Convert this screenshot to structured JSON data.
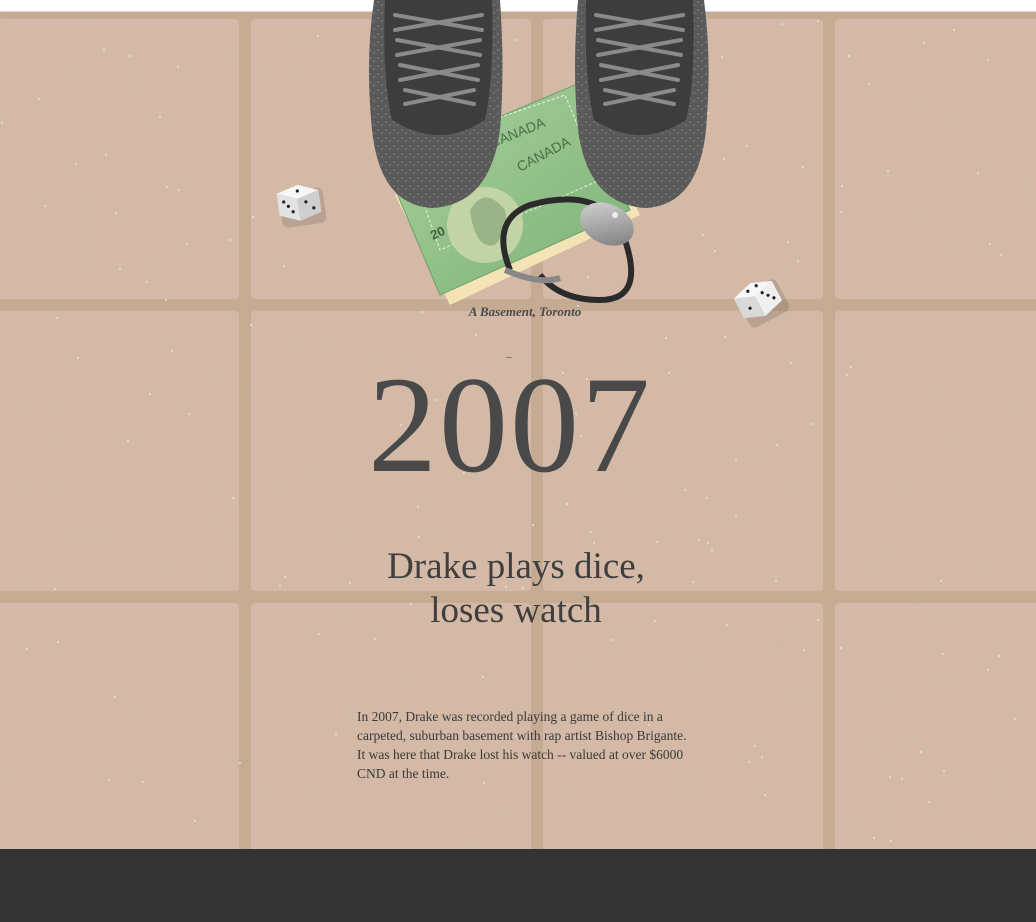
{
  "scene": {
    "location_caption": "A Basement, Toronto",
    "separator": "–",
    "bill_country_text": "CANADA",
    "bill_denomination": "20"
  },
  "story": {
    "year": "2007",
    "headline_line1": "Drake plays dice,",
    "headline_line2": "loses watch",
    "body": "In 2007, Drake was recorded playing a game of dice in a carpeted, suburban basement with rap artist Bishop Brigante. It was here that Drake lost his watch -- valued at over $6000 CND at the time."
  },
  "colors": {
    "floor_grout": "#c6ab93",
    "floor_tile": "#d3b9a6",
    "footer": "#333333",
    "text": "#3f3f3f"
  }
}
